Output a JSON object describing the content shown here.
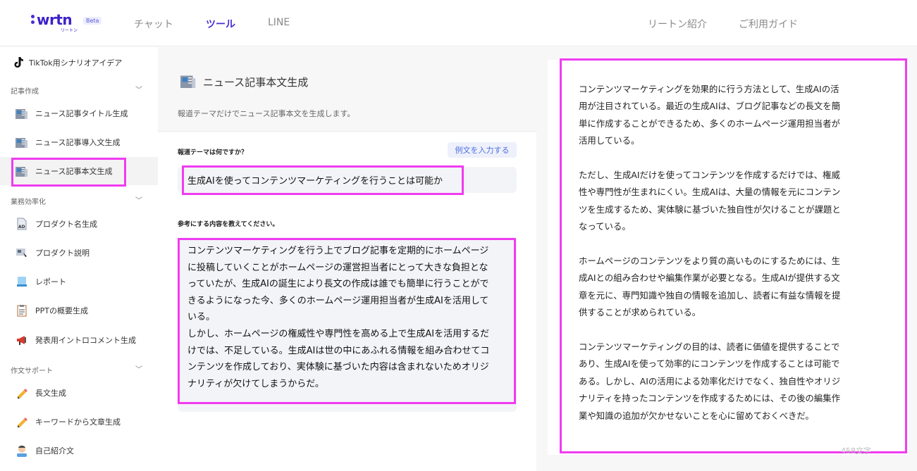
{
  "header": {
    "logo_text": "wrtn",
    "logo_sub": "リートン",
    "beta": "Beta",
    "nav": [
      "チャット",
      "ツール",
      "LINE"
    ],
    "right_nav": [
      "リートン紹介",
      "ご利用ガイド"
    ]
  },
  "sidebar": {
    "top_item": "TikTok用シナリオアイデア",
    "sections": [
      {
        "title": "記事作成",
        "items": [
          "ニュース記事タイトル生成",
          "ニュース記事導入文生成",
          "ニュース記事本文生成"
        ]
      },
      {
        "title": "業務効率化",
        "items": [
          "プロダクト名生成",
          "プロダクト説明",
          "レポート",
          "PPTの概要生成",
          "発表用イントロコメント生成"
        ]
      },
      {
        "title": "作文サポート",
        "items": [
          "長文生成",
          "キーワードから文章生成",
          "自己紹介文"
        ]
      }
    ]
  },
  "main": {
    "title": "ニュース記事本文生成",
    "description": "報道テーマだけでニュース記事本文を生成します。",
    "q1_label": "報道テーマは何ですか？",
    "example_button": "例文を入力する",
    "q1_value": "生成AIを使ってコンテンツマーケティングを行うことは可能か",
    "q2_label": "参考にする内容を教えてください。",
    "q2_value_lines": [
      "コンテンツマーケティングを行う上でブログ記事を定期的にホームページ",
      "に投稿していくことがホームページの運営担当者にとって大きな負担とな",
      "っていたが、生成AIの誕生により長文の作成は誰でも簡単に行うことがで",
      "きるようになった今、多くのホームページ運用担当者が生成AIを活用して",
      "いる。",
      "しかし、ホームページの権威性や専門性を高める上で生成AIを活用するだ",
      "けでは、不足している。生成AIは世の中にあふれる情報を組み合わせてコ",
      "ンテンツを作成しており、実体験に基づいた内容は含まれないためオリジ",
      "ナリティが欠けてしまうからだ。"
    ]
  },
  "result": {
    "paragraphs": [
      [
        "コンテンツマーケティングを効果的に行う方法として、生成AIの活",
        "用が注目されている。最近の生成AIは、ブログ記事などの長文を簡",
        "単に作成することができるため、多くのホームページ運用担当者が",
        "活用している。"
      ],
      [
        "ただし、生成AIだけを使ってコンテンツを作成するだけでは、権威",
        "性や専門性が生まれにくい。生成AIは、大量の情報を元にコンテン",
        "ツを生成するため、実体験に基づいた独自性が欠けることが課題と",
        "なっている。"
      ],
      [
        "ホームページのコンテンツをより質の高いものにするためには、生",
        "成AIとの組み合わせや編集作業が必要となる。生成AIが提供する文",
        "章を元に、専門知識や独自の情報を追加し、読者に有益な情報を提",
        "供することが求められている。"
      ],
      [
        "コンテンツマーケティングの目的は、読者に価値を提供することで",
        "あり、生成AIを使って効率的にコンテンツを作成することは可能で",
        "ある。しかし、AIの活用による効率化だけでなく、独自性やオリジ",
        "ナリティを持ったコンテンツを作成するためには、その後の編集作",
        "業や知識の追加が欠かせないことを心に留めておくべきだ。"
      ]
    ],
    "char_count": "458文字"
  },
  "colors": {
    "accent": "#4a2bd6",
    "highlight": "#f03cf0",
    "link": "#4c6fe0"
  }
}
